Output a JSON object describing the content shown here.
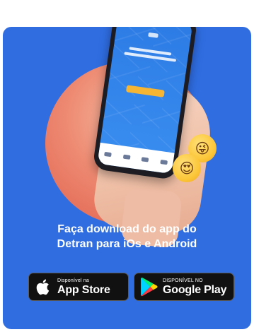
{
  "headline": {
    "line1": "Faça download do app do",
    "line2": "Detran para iOs e Android"
  },
  "badges": {
    "apple": {
      "small_label": "Disponível na",
      "big_label": "App Store",
      "icon": "apple-logo-icon"
    },
    "google": {
      "small_label": "DISPONÍVEL NO",
      "big_label": "Google Play",
      "icon": "google-play-logo-icon"
    }
  },
  "emojis": [
    "winking-face-tongue-icon",
    "heart-eyes-face-icon"
  ],
  "colors": {
    "card_background": "#2f6de1",
    "circle_accent": "#ee8a72",
    "badge_background": "#111111",
    "screen_button": "#f6b533"
  }
}
